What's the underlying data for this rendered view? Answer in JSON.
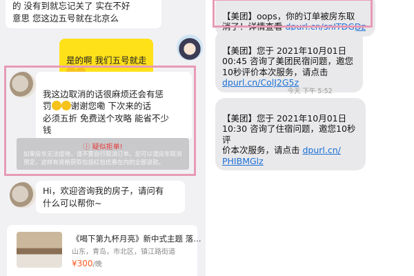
{
  "chat": {
    "msg_top": "的 没有到就忘记关了 实在不好\n意思 您这边五号就在北京么",
    "msg_reply": "是的啊 我们五号就走",
    "msg_cancel": "我这边取消的话很麻烦还会有惩\n罚",
    "msg_cancel_2": "谢谢您嘞 下次来的话\n必须五折 免费送个攻略 能省不少\n钱",
    "warning_title": "疑似拒单!",
    "warning_text": "如果房东无法接待，请不要自行取消订单。您可以请房东取消预定，这样有资格获取包括红包优惠在内的全部退款。",
    "msg_greeting": "Hi，欢迎咨询我的房子，请问有\n什么可以帮你~",
    "listing": {
      "title": "《喝下第九杯月亮》新中式主题 落…",
      "location": "山东，青岛，市北区，镇江路街道",
      "price": "¥300",
      "unit": "/晚"
    },
    "icons": {
      "avatar_host": "cat-avatar",
      "avatar_guest": "anime-girl-avatar",
      "warning": "warning-icon"
    }
  },
  "sms": {
    "msg1_text": "【美团】oops，你的订单被房东取\n消了！详情查看 ",
    "msg1_link": "dpurl.cn/snITDGDz",
    "msg2_text": "【美团】您于 2021年10月01日\n00:45 咨询了美团民宿问题，邀您\n10秒评价本次服务，请点击\n",
    "msg2_link": "dpurl.cn/ColJ2G5z",
    "timestamp": "今天 下午 5:52",
    "msg3_text": "【美团】您于 2021年10月01日\n10:30 咨询了住宿问题，邀您10秒评\n价本次服务，请点击 ",
    "msg3_link_a": "dpurl.cn/",
    "msg3_link_b": "PHIBMGlz"
  },
  "colors": {
    "highlight_border": "#e79bb4",
    "reply_bubble": "#ffe11a",
    "link": "#1a6fd6",
    "price": "#ff5a1f"
  }
}
